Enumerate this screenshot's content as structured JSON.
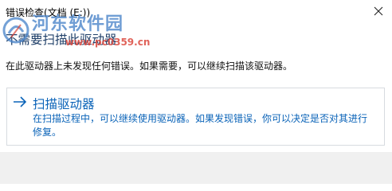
{
  "window": {
    "title": "错误检查(文档 (E:))",
    "close_icon": "close-icon"
  },
  "heading": "不需要扫描此驱动器",
  "message": "在此驱动器上未发现任何错误。如果需要，可以继续扫描该驱动器。",
  "scan_option": {
    "icon": "arrow-right-icon",
    "title": "扫描驱动器",
    "description": "在扫描过程中，可以继续使用驱动器。如果发现错误，你可以决定是否对其进行修复。"
  },
  "watermark": {
    "text": "河东软件园",
    "url": "www.pc0359.cn"
  },
  "colors": {
    "accent": "#0a63b8",
    "heading": "#1f3f68",
    "border": "#d7dbe0",
    "footer_bg": "#f0f0f0"
  }
}
